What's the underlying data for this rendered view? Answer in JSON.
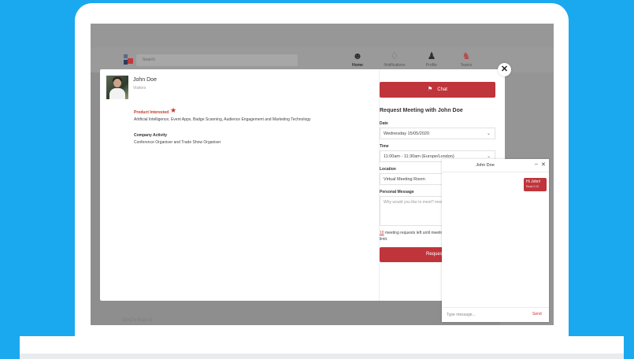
{
  "app": {
    "search_placeholder": "Search",
    "nav": [
      {
        "label": "Home",
        "icon": "people-icon"
      },
      {
        "label": "Notifications",
        "icon": "bell-icon"
      },
      {
        "label": "Profile",
        "icon": "person-icon"
      },
      {
        "label": "Teams",
        "icon": "team-icon"
      }
    ],
    "footer_text": "OnDemand"
  },
  "profile": {
    "name": "John Doe",
    "role": "Visitors",
    "product_interested_label": "Product Interested",
    "product_interested_value": "Artificial Intelligence, Event Apps, Badge Scanning, Audience Engagement and Marketing Technology",
    "company_activity_label": "Company Activity",
    "company_activity_value": "Conference Organiser and Trade Show Organiser"
  },
  "meeting": {
    "chat_button": "Chat",
    "title": "Request Meeting with John Doe",
    "date_label": "Date",
    "date_value": "Wednesday 15/05/2020",
    "time_label": "Time",
    "time_value": "11:00am - 11:30am (Europe/London)",
    "location_label": "Location",
    "location_value": "Virtual Meeting Room",
    "message_label": "Personal Message",
    "message_placeholder": "Why would you like to meet? message increases acceptan",
    "limit_count": "10",
    "limit_text": " meeting requests left until meeting limit.",
    "request_button": "Request M"
  },
  "chat": {
    "title": "John Doe",
    "message": "Hi John!",
    "message_time": "Read 0:10",
    "input_placeholder": "Type message...",
    "send_label": "Send"
  },
  "colors": {
    "accent": "#c0343b",
    "background": "#1aa9ef"
  }
}
